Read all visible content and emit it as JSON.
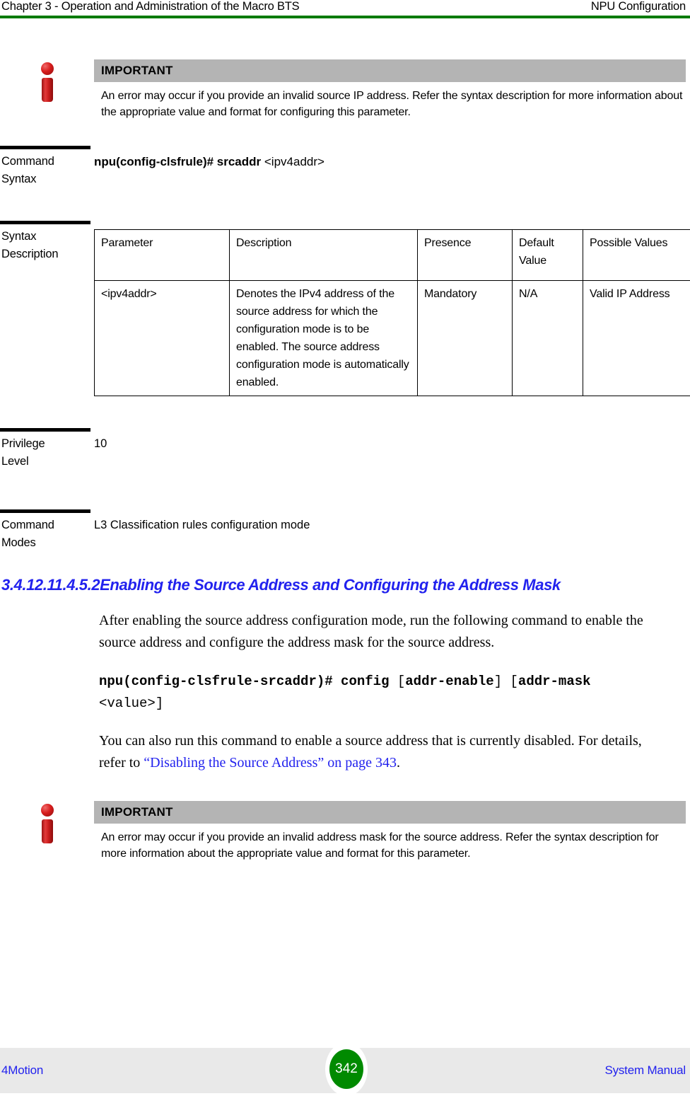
{
  "header": {
    "left": "Chapter 3 - Operation and Administration of the Macro BTS",
    "right": "NPU Configuration",
    "rule_color": "#007b00"
  },
  "note_top": {
    "icon": "info-icon",
    "title": "IMPORTANT",
    "text": "An error may occur if you provide an invalid source IP address. Refer the syntax description for more information about the appropriate value and format for configuring this parameter.",
    "title_bar_color": "#b4b4b4",
    "icon_color": "#c81c1c"
  },
  "command_syntax": {
    "label_line1": "Command",
    "label_line2": "Syntax",
    "command_bold": "npu(config-clsfrule)# srcaddr",
    "command_arg": "<ipv4addr>"
  },
  "syntax_description": {
    "label_line1": "Syntax",
    "label_line2": "Description",
    "columns": [
      "Parameter",
      "Description",
      "Presence",
      "Default Value",
      "Possible Values"
    ],
    "rows": [
      {
        "parameter": "<ipv4addr>",
        "description": "Denotes the IPv4 address of the source address for which the configuration mode is to be enabled. The source address configuration mode is automatically enabled.",
        "presence": "Mandatory",
        "default_value": "N/A",
        "possible_values": "Valid IP Address"
      }
    ]
  },
  "privilege_level": {
    "label_line1": "Privilege",
    "label_line2": "Level",
    "value": "10"
  },
  "command_modes": {
    "label_line1": "Command",
    "label_line2": "Modes",
    "value": "L3 Classification rules configuration mode"
  },
  "section": {
    "heading": "3.4.12.11.4.5.2Enabling the Source Address and Configuring the Address Mask",
    "heading_color": "#2222ee",
    "paragraph_1": "After enabling the source address configuration mode, run the following command to enable the source address and configure the address mask for the source address.",
    "command": {
      "prompt": "npu(config-clsfrule-srcaddr)# config",
      "open_bracket_1": " [",
      "option_1": "addr-enable",
      "close_bracket_1": "] ",
      "open_bracket_2": "[",
      "option_2": "addr-mask",
      "value_line": "<value>]"
    },
    "paragraph_2_before": "You can also run this command to enable a source address that is currently disabled. For details, refer to ",
    "paragraph_2_link": "“Disabling the Source Address” on page 343",
    "paragraph_2_after": "."
  },
  "note_bottom": {
    "icon": "info-icon",
    "title": "IMPORTANT",
    "text": "An error may occur if you provide an invalid address mask for the source address. Refer the syntax description for more information about the appropriate value and format for this parameter.",
    "title_bar_color": "#b4b4b4",
    "icon_color": "#c81c1c"
  },
  "footer": {
    "left": "4Motion",
    "page_number": "342",
    "right": "System Manual",
    "badge_color": "#008a00",
    "band_color": "#e9e9e9",
    "link_color": "#2222ee"
  }
}
